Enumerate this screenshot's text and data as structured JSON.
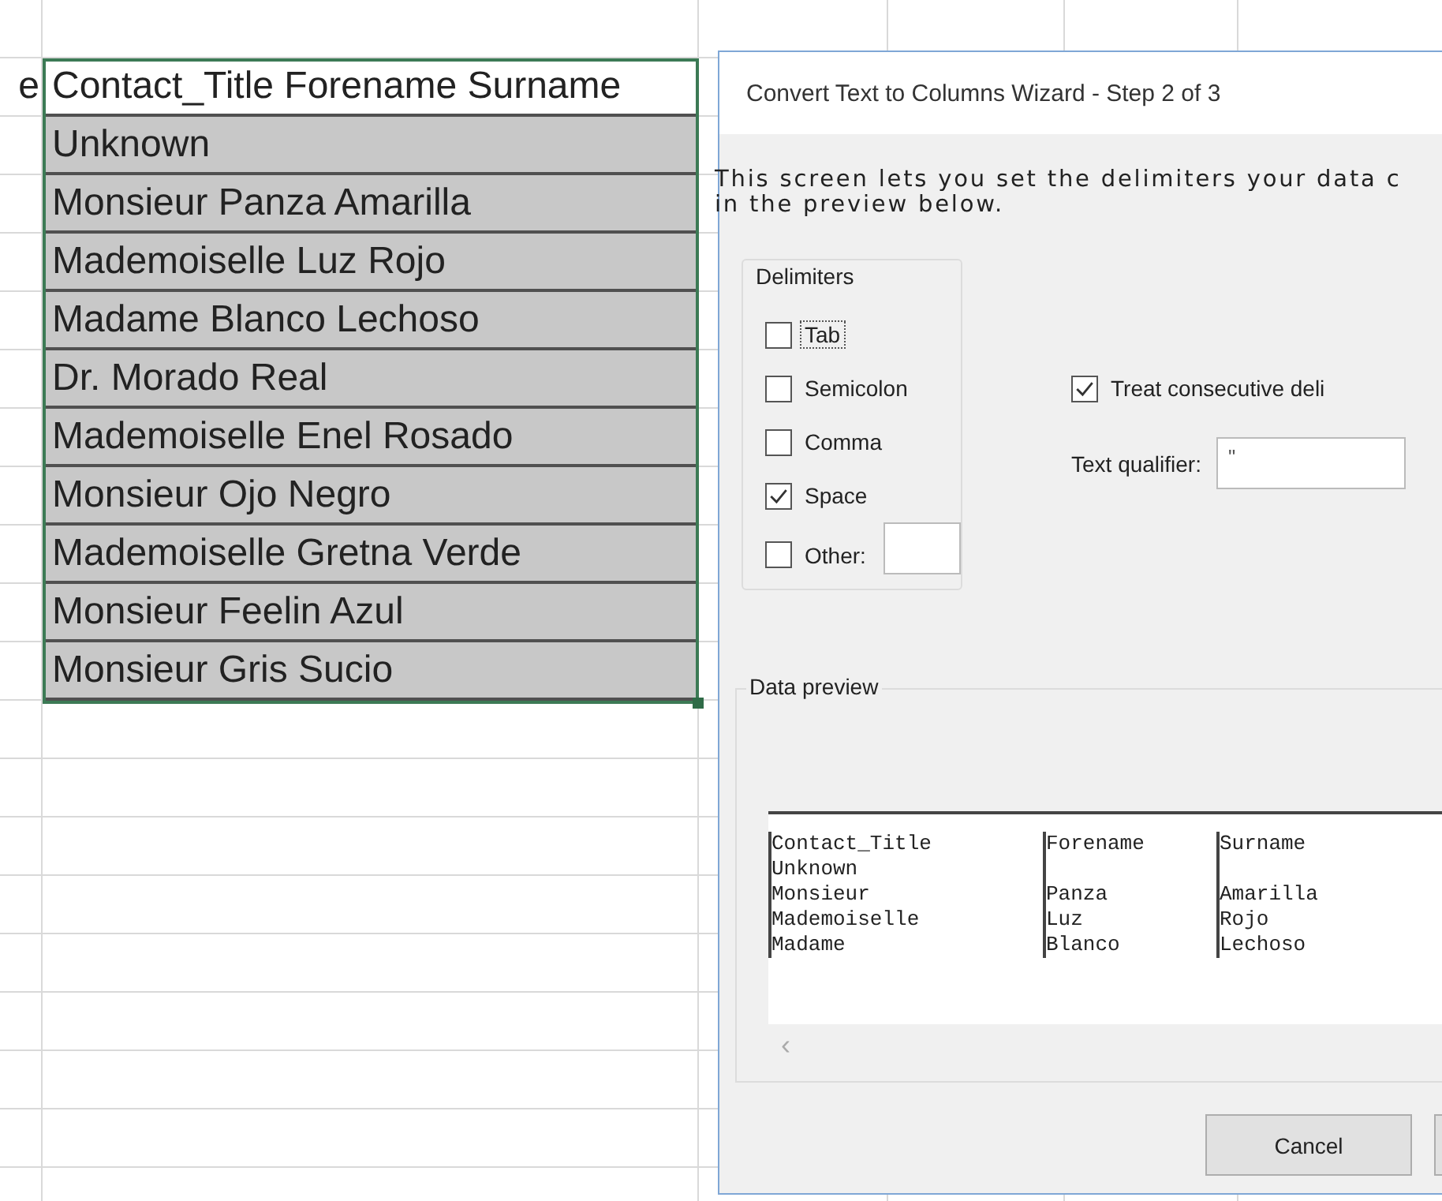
{
  "sheet": {
    "rows": [
      {
        "column_1": "e",
        "column_2": "Contact_Title Forename Surname",
        "selected": true,
        "active": true
      },
      {
        "column_2": "Unknown",
        "selected": true,
        "active": false
      },
      {
        "column_2": "Monsieur Panza Amarilla",
        "selected": true,
        "active": false
      },
      {
        "column_2": "Mademoiselle Luz Rojo",
        "selected": true,
        "active": false
      },
      {
        "column_2": "Madame Blanco Lechoso",
        "selected": true,
        "active": false
      },
      {
        "column_2": "Dr. Morado Real",
        "selected": true,
        "active": false
      },
      {
        "column_2": "Mademoiselle Enel Rosado",
        "selected": true,
        "active": false
      },
      {
        "column_2": "Monsieur Ojo Negro",
        "selected": true,
        "active": false
      },
      {
        "column_2": "Mademoiselle Gretna Verde",
        "selected": true,
        "active": false
      },
      {
        "column_2": "Monsieur Feelin Azul",
        "selected": true,
        "active": false
      },
      {
        "column_2": "Monsieur Gris Sucio",
        "selected": true,
        "active": false
      }
    ]
  },
  "dialog": {
    "title": "Convert Text to Columns Wizard - Step 2 of 3",
    "description": [
      "This screen lets you set the delimiters your data c",
      "in the preview below."
    ],
    "delimiters": {
      "title": "Delimiters",
      "items": [
        {
          "kind": "plain",
          "label": "Tab",
          "checked": false,
          "focused": true
        },
        {
          "kind": "plain",
          "label": "Semicolon",
          "checked": false,
          "focused": false
        },
        {
          "kind": "plain",
          "label": "Comma",
          "checked": false,
          "focused": false
        },
        {
          "kind": "plain",
          "label": "Space",
          "checked": true,
          "focused": false
        },
        {
          "kind": "other",
          "label": "Other:",
          "checked": false,
          "focused": false
        }
      ]
    },
    "treat_consecutive": {
      "label": "Treat consecutive deli",
      "checked": true
    },
    "text_qualifier": {
      "label": "Text qualifier:",
      "value": "\""
    },
    "data_preview": {
      "title": "Data preview",
      "rows": [
        [
          "Contact_Title",
          "Forename",
          "Surname"
        ],
        [
          "Unknown"
        ],
        [
          "Monsieur",
          "Panza",
          "Amarilla"
        ],
        [
          "Mademoiselle",
          "Luz",
          "Rojo"
        ],
        [
          "Madame",
          "Blanco",
          "Lechoso"
        ]
      ],
      "scroll_left": "‹"
    },
    "buttons": [
      "Cancel"
    ]
  }
}
